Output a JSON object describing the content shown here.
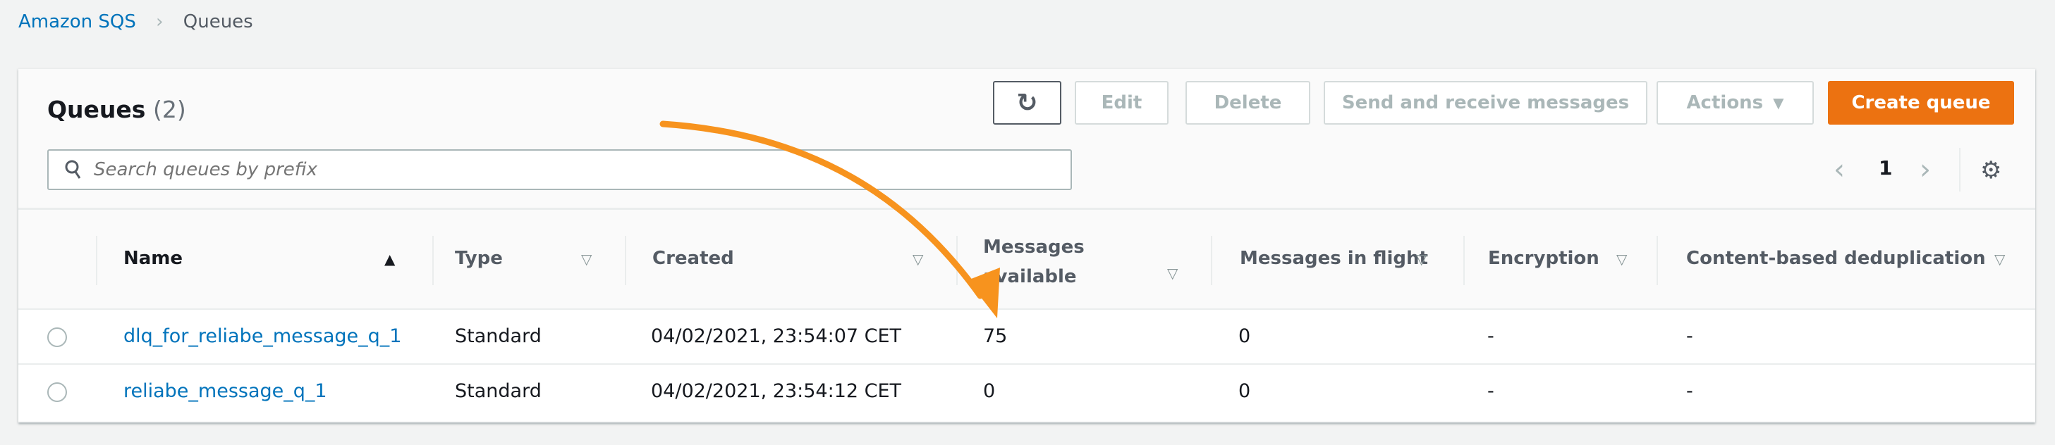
{
  "breadcrumb": {
    "root": "Amazon SQS",
    "separator": "›",
    "current": "Queues"
  },
  "panel": {
    "title": "Queues",
    "count": "(2)"
  },
  "toolbar": {
    "refresh_icon": "refresh-icon",
    "edit": "Edit",
    "delete": "Delete",
    "send": "Send and receive messages",
    "actions": "Actions",
    "actions_caret": "▼",
    "create": "Create queue",
    "create_color": "#ec7211"
  },
  "search": {
    "placeholder": "Search queues by prefix",
    "value": ""
  },
  "pagination": {
    "prev": "‹",
    "page": "1",
    "next": "›",
    "settings_icon": "gear-icon"
  },
  "table": {
    "columns": [
      {
        "label": "Name",
        "sort": "▲"
      },
      {
        "label": "Type",
        "sort": "▽"
      },
      {
        "label": "Created",
        "sort": "▽"
      },
      {
        "label": "Messages available",
        "sort": "▽"
      },
      {
        "label": "Messages in flight",
        "sort": "▽"
      },
      {
        "label": "Encryption",
        "sort": "▽"
      },
      {
        "label": "Content-based deduplication",
        "sort": "▽"
      }
    ],
    "rows": [
      {
        "name": "dlq_for_reliabe_message_q_1",
        "type": "Standard",
        "created": "04/02/2021, 23:54:07 CET",
        "available": "75",
        "in_flight": "0",
        "encryption": "-",
        "dedup": "-"
      },
      {
        "name": "reliabe_message_q_1",
        "type": "Standard",
        "created": "04/02/2021, 23:54:12 CET",
        "available": "0",
        "in_flight": "0",
        "encryption": "-",
        "dedup": "-"
      }
    ]
  },
  "annotation": {
    "arrow_color": "#f7931e"
  }
}
